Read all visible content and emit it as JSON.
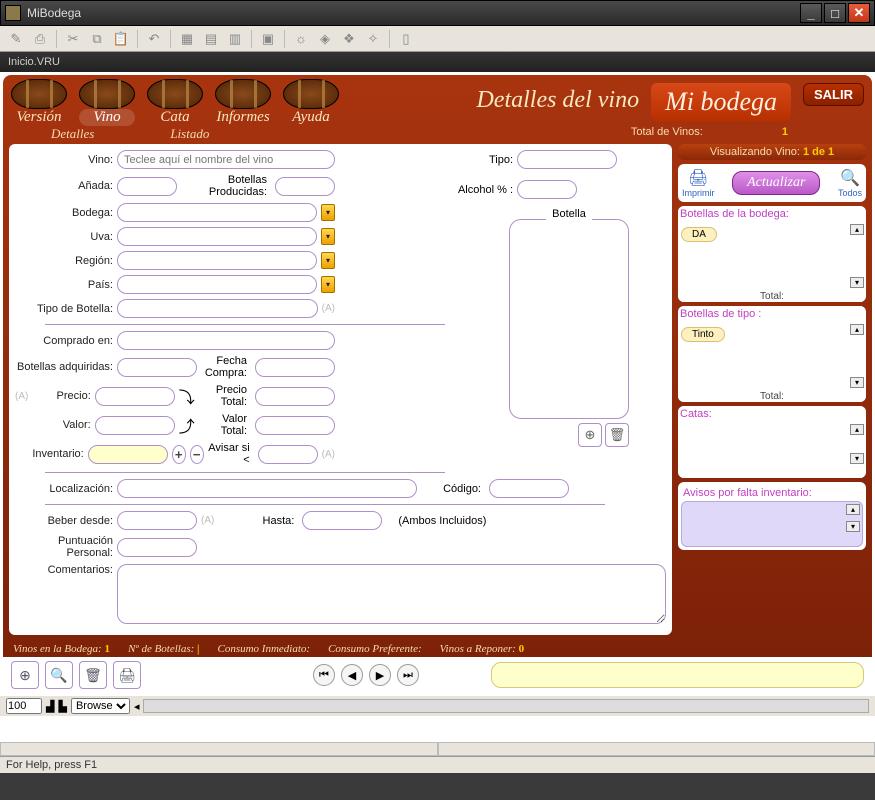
{
  "window": {
    "title": "MiBodega"
  },
  "innerTitle": "Inicio.VRU",
  "nav": {
    "items": [
      "Versión",
      "Vino",
      "Cata",
      "Informes",
      "Ayuda"
    ],
    "sub": [
      "Detalles",
      "Listado"
    ],
    "pageTitle": "Detalles del vino",
    "brand": "Mi bodega",
    "salir": "SALIR"
  },
  "counts": {
    "totalLabel": "Total de Vinos:",
    "total": "1",
    "viewLabel": "Visualizando Vino:",
    "viewOf": "1 de 1"
  },
  "labels": {
    "vino": "Vino:",
    "anada": "Añada:",
    "botProd": "Botellas Producidas:",
    "bodega": "Bodega:",
    "uva": "Uva:",
    "region": "Región:",
    "pais": "País:",
    "tipoBotella": "Tipo de Botella:",
    "tipo": "Tipo:",
    "alcohol": "Alcohol % :",
    "botella": "Botella",
    "compradoEn": "Comprado en:",
    "botAdq": "Botellas adquiridas:",
    "fechaCompra": "Fecha Compra:",
    "precio": "Precio:",
    "precioTotal": "Precio Total:",
    "valor": "Valor:",
    "valorTotal": "Valor Total:",
    "inventario": "Inventario:",
    "avisar": "Avisar si <",
    "localizacion": "Localización:",
    "codigo": "Código:",
    "beberDesde": "Beber desde:",
    "hasta": "Hasta:",
    "ambos": "(Ambos Incluidos)",
    "puntuacion": "Puntuación Personal:",
    "comentarios": "Comentarios:"
  },
  "placeholders": {
    "vino": "Teclee aquí el nombre del vino"
  },
  "side": {
    "imprimir": "Imprimir",
    "actualizar": "Actualizar",
    "todos": "Todos",
    "botBodega": "Botellas de la bodega:",
    "da": "DA",
    "total": "Total:",
    "botTipo": "Botellas de tipo :",
    "tinto": "Tinto",
    "catas": "Catas:",
    "avisos": "Avisos por falta inventario:"
  },
  "stats": {
    "vinosBodega": "Vinos en la Bodega:",
    "vinosBodegaN": "1",
    "nBot": "Nº de Botellas:",
    "nBotN": "|",
    "consInm": "Consumo Inmediato:",
    "consPref": "Consumo Preferente:",
    "reponer": "Vinos a Reponer:",
    "reponerN": "0"
  },
  "footer": {
    "zoom": "100",
    "mode": "Browse",
    "status": "For Help, press F1"
  }
}
